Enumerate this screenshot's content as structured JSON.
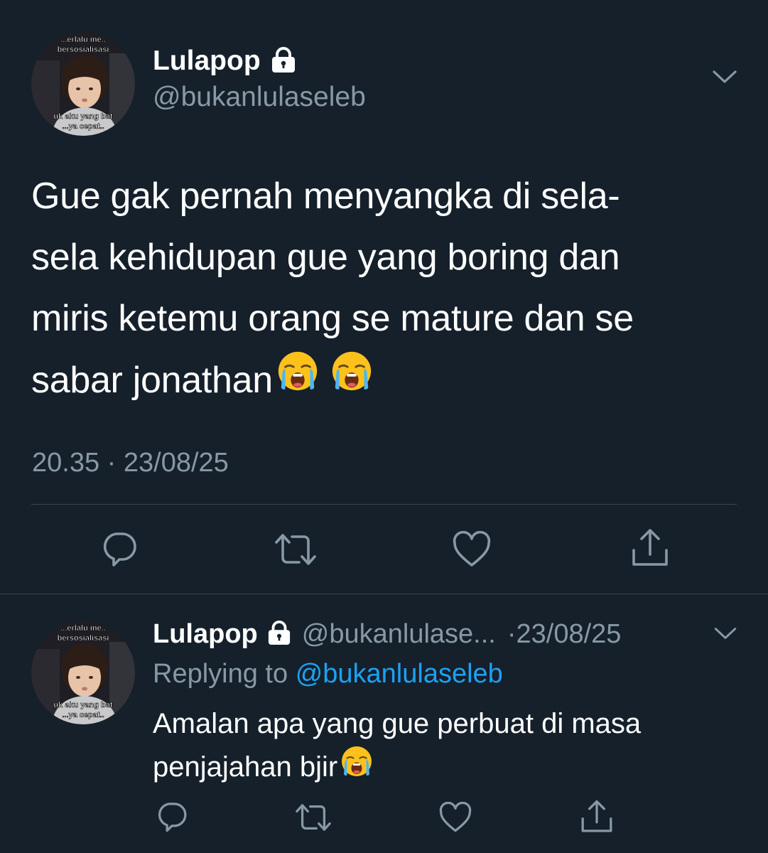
{
  "main_tweet": {
    "display_name": "Lulapop",
    "handle": "@bukanlulaseleb",
    "text_lines": [
      "Gue gak pernah menyangka di sela-",
      "sela kehidupan gue yang boring dan",
      "miris ketemu orang se mature dan se",
      "sabar jonathan"
    ],
    "timestamp": "20.35 · 23/08/25",
    "avatar_caption_top": [
      "...erlalu me..",
      "bersosialisasi"
    ],
    "avatar_caption_bottom": [
      "uk aku yang bat",
      "...ya cepat.."
    ]
  },
  "reply_tweet": {
    "display_name": "Lulapop",
    "handle": "@bukanlulase...",
    "date": "·23/08/25",
    "replying_prefix": "Replying to",
    "replying_handle": "@bukanlulaseleb",
    "text_lines": [
      "Amalan apa yang gue perbuat di masa",
      "penjajahan bjir"
    ],
    "avatar_caption_top": [
      "...erlalu me..",
      "bersosialisasi"
    ],
    "avatar_caption_bottom": [
      "uk aku yang bat",
      "...ya cepat.."
    ]
  },
  "icons": {
    "lock": "lock-icon",
    "chevron": "chevron-down-icon",
    "reply": "reply-icon",
    "retweet": "retweet-icon",
    "like": "like-icon",
    "share": "share-icon",
    "emoji": "loudly-crying-face"
  },
  "colors": {
    "background": "#15202b",
    "text": "#ffffff",
    "muted": "#8899a6",
    "link": "#1da1f2",
    "divider": "#38444d"
  }
}
